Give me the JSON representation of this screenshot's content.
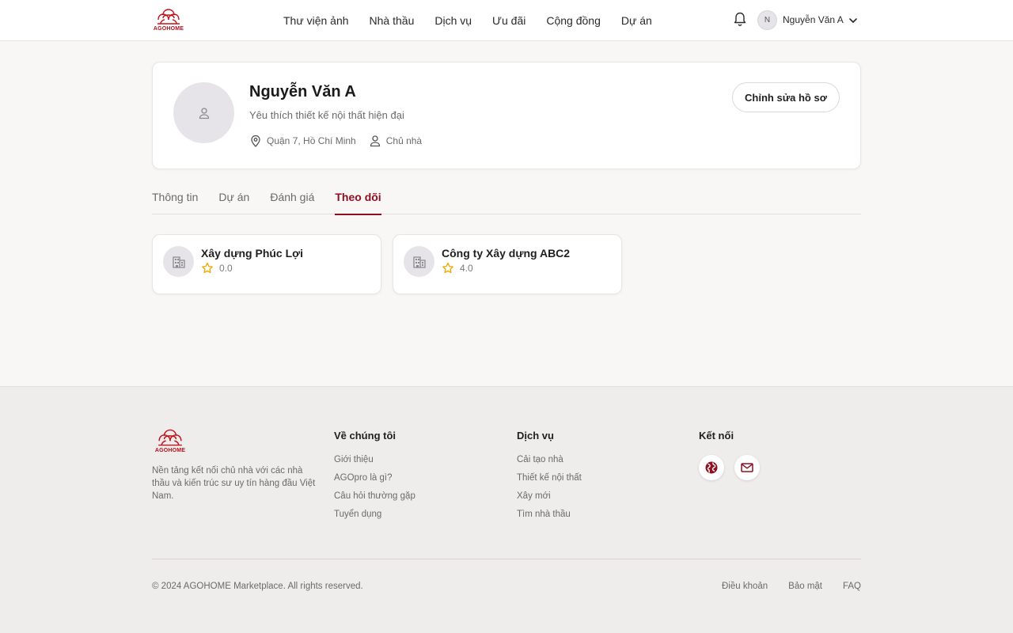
{
  "brand": {
    "name": "AGOHOME",
    "color": "#c4121d",
    "accent": "#8e1020"
  },
  "header": {
    "nav": [
      "Thư viện ảnh",
      "Nhà thầu",
      "Dịch vụ",
      "Ưu đãi",
      "Cộng đồng",
      "Dự án"
    ],
    "notification_icon": "bell-icon",
    "user": {
      "initial": "N",
      "name": "Nguyễn Văn A"
    }
  },
  "profile": {
    "name": "Nguyễn Văn A",
    "bio": "Yêu thích thiết kế nội thất hiện đại",
    "location": "Quận 7, Hồ Chí Minh",
    "role": "Chủ nhà",
    "edit_label": "Chỉnh sửa hồ sơ"
  },
  "tabs": {
    "items": [
      "Thông tin",
      "Dự án",
      "Đánh giá",
      "Theo dõi"
    ],
    "active": "Theo dõi"
  },
  "following": [
    {
      "name": "Xây dựng Phúc Lợi",
      "rating": "0.0"
    },
    {
      "name": "Công ty Xây dựng ABC2",
      "rating": "4.0"
    }
  ],
  "footer": {
    "description": "Nền tảng kết nối chủ nhà với các nhà thầu và kiến trúc sư uy tín hàng đầu Việt Nam.",
    "about": {
      "title": "Về chúng tôi",
      "links": [
        "Giới thiệu",
        "AGOpro là gì?",
        "Câu hỏi thường gặp",
        "Tuyển dụng"
      ]
    },
    "services": {
      "title": "Dịch vụ",
      "links": [
        "Cải tạo nhà",
        "Thiết kế nội thất",
        "Xây mới",
        "Tìm nhà thầu"
      ]
    },
    "connect": {
      "title": "Kết nối",
      "icons": [
        "globe-icon",
        "mail-icon"
      ]
    },
    "copyright": "© 2024 AGOHOME Marketplace. All rights reserved.",
    "legal": [
      "Điều khoản",
      "Bảo mật",
      "FAQ"
    ]
  }
}
